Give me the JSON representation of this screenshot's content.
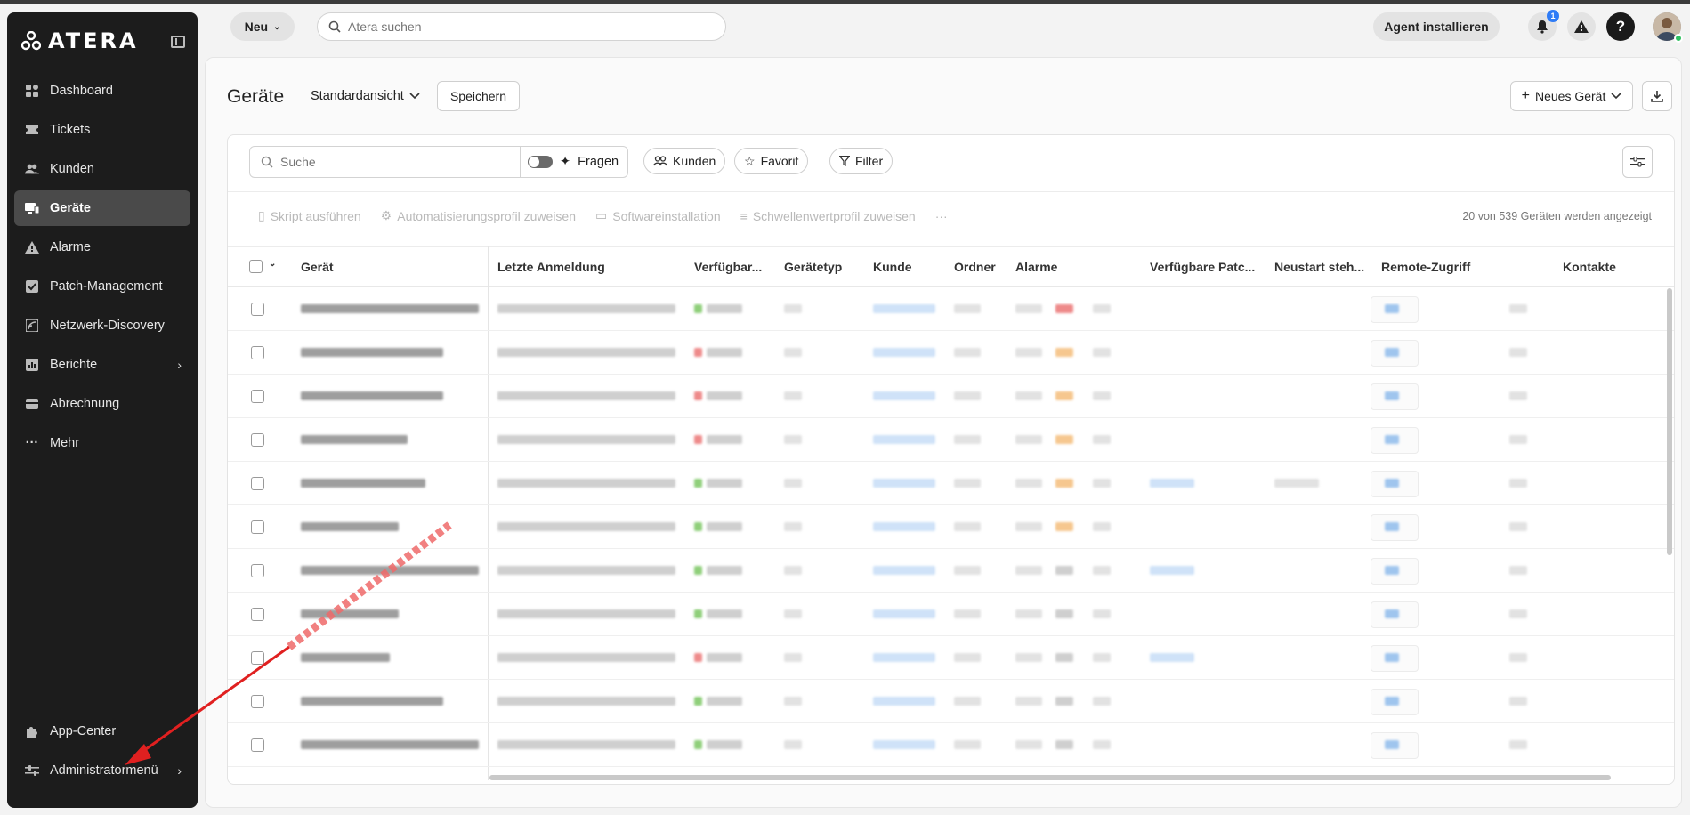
{
  "sidebar": {
    "brand": "ATERA",
    "items": [
      {
        "label": "Dashboard",
        "icon": "dashboard-icon"
      },
      {
        "label": "Tickets",
        "icon": "ticket-icon"
      },
      {
        "label": "Kunden",
        "icon": "users-icon"
      },
      {
        "label": "Geräte",
        "icon": "devices-icon",
        "active": true
      },
      {
        "label": "Alarme",
        "icon": "warning-icon"
      },
      {
        "label": "Patch-Management",
        "icon": "patch-icon"
      },
      {
        "label": "Netzwerk-Discovery",
        "icon": "network-icon"
      },
      {
        "label": "Berichte",
        "icon": "reports-icon",
        "chevron": true
      },
      {
        "label": "Abrechnung",
        "icon": "billing-icon"
      },
      {
        "label": "Mehr",
        "icon": "more-icon"
      }
    ],
    "bottom": [
      {
        "label": "App-Center",
        "icon": "puzzle-icon"
      },
      {
        "label": "Administratormenü",
        "icon": "sliders-icon",
        "chevron": true
      }
    ]
  },
  "topbar": {
    "new_label": "Neu",
    "search_placeholder": "Atera suchen",
    "agent_label": "Agent installieren",
    "notification_count": "1",
    "help_label": "?"
  },
  "page": {
    "title": "Geräte",
    "view": "Standardansicht",
    "save_label": "Speichern",
    "new_device_label": "Neues Gerät"
  },
  "toolbar": {
    "search_placeholder": "Suche",
    "ask_label": "Fragen",
    "customers_label": "Kunden",
    "favorite_label": "Favorit",
    "filter_label": "Filter"
  },
  "actions": {
    "run_script": "Skript ausführen",
    "assign_automation": "Automatisierungsprofil zuweisen",
    "software_install": "Softwareinstallation",
    "assign_threshold": "Schwellenwertprofil zuweisen",
    "more": "···",
    "count_text": "20 von 539 Geräten werden angezeigt"
  },
  "table": {
    "columns": [
      "Gerät",
      "Letzte Anmeldung",
      "Verfügbar...",
      "Gerätetyp",
      "Kunde",
      "Ordner",
      "Alarme",
      "Verfügbare Patc...",
      "Neustart steh...",
      "Remote-Zugriff",
      "Kontakte"
    ],
    "status_colors": [
      "green",
      "red",
      "red",
      "red",
      "green",
      "green",
      "green",
      "green",
      "red",
      "green",
      "green"
    ]
  },
  "colors": {
    "sidebar_bg": "#1c1c1c",
    "active_item": "#4a4a4a",
    "accent": "#2f7cf6",
    "annotation_arrow": "#e02020"
  }
}
